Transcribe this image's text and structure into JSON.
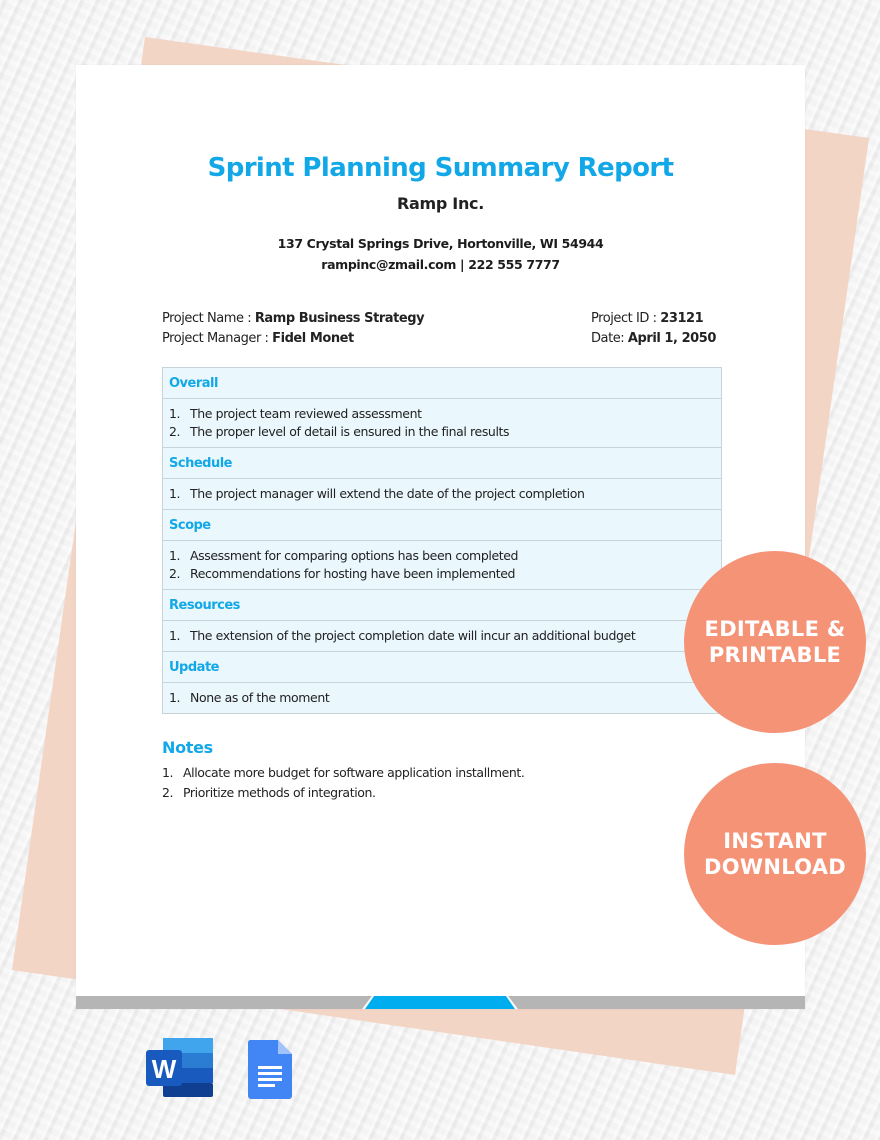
{
  "document": {
    "title": "Sprint Planning Summary Report",
    "company": "Ramp Inc.",
    "address": "137 Crystal Springs Drive, Hortonville, WI 54944",
    "contact": "rampinc@zmail.com | 222 555 7777",
    "meta": {
      "project_name_label": "Project Name : ",
      "project_name_value": "Ramp Business Strategy",
      "project_manager_label": "Project Manager : ",
      "project_manager_value": "Fidel Monet",
      "project_id_label": "Project ID : ",
      "project_id_value": "23121",
      "date_label": "Date: ",
      "date_value": "April 1, 2050"
    },
    "sections": [
      {
        "heading": "Overall",
        "items": [
          {
            "num": "1.",
            "text": "The project team reviewed assessment"
          },
          {
            "num": "2.",
            "text": "The proper level of detail is ensured in the final results"
          }
        ]
      },
      {
        "heading": "Schedule",
        "items": [
          {
            "num": "1.",
            "text": "The project manager will extend the date of the project completion"
          }
        ]
      },
      {
        "heading": "Scope",
        "items": [
          {
            "num": "1.",
            "text": "Assessment for comparing options has been completed"
          },
          {
            "num": "2.",
            "text": "Recommendations for hosting have been implemented"
          }
        ]
      },
      {
        "heading": "Resources",
        "items": [
          {
            "num": "1.",
            "text": "The extension of the project completion date will incur an additional budget"
          }
        ]
      },
      {
        "heading": "Update",
        "items": [
          {
            "num": "1.",
            "text": "None as of the moment"
          }
        ]
      }
    ],
    "notes": {
      "heading": "Notes",
      "items": [
        {
          "num": "1.",
          "text": "Allocate more budget for software application installment."
        },
        {
          "num": "2.",
          "text": "Prioritize methods of integration."
        }
      ]
    }
  },
  "badges": {
    "editable": {
      "line1": "EDITABLE &",
      "line2": "PRINTABLE"
    },
    "download": {
      "line1": "INSTANT",
      "line2": "DOWNLOAD"
    }
  },
  "app_icons": [
    {
      "name": "microsoft-word-icon",
      "letter": "W"
    },
    {
      "name": "google-docs-icon"
    }
  ],
  "colors": {
    "accent_blue": "#12a8e8",
    "table_fill": "#eaf7fd",
    "badge_coral": "#f59377",
    "sheet_peach": "#f3d5c6",
    "footer_gray": "#b5b5b5"
  }
}
